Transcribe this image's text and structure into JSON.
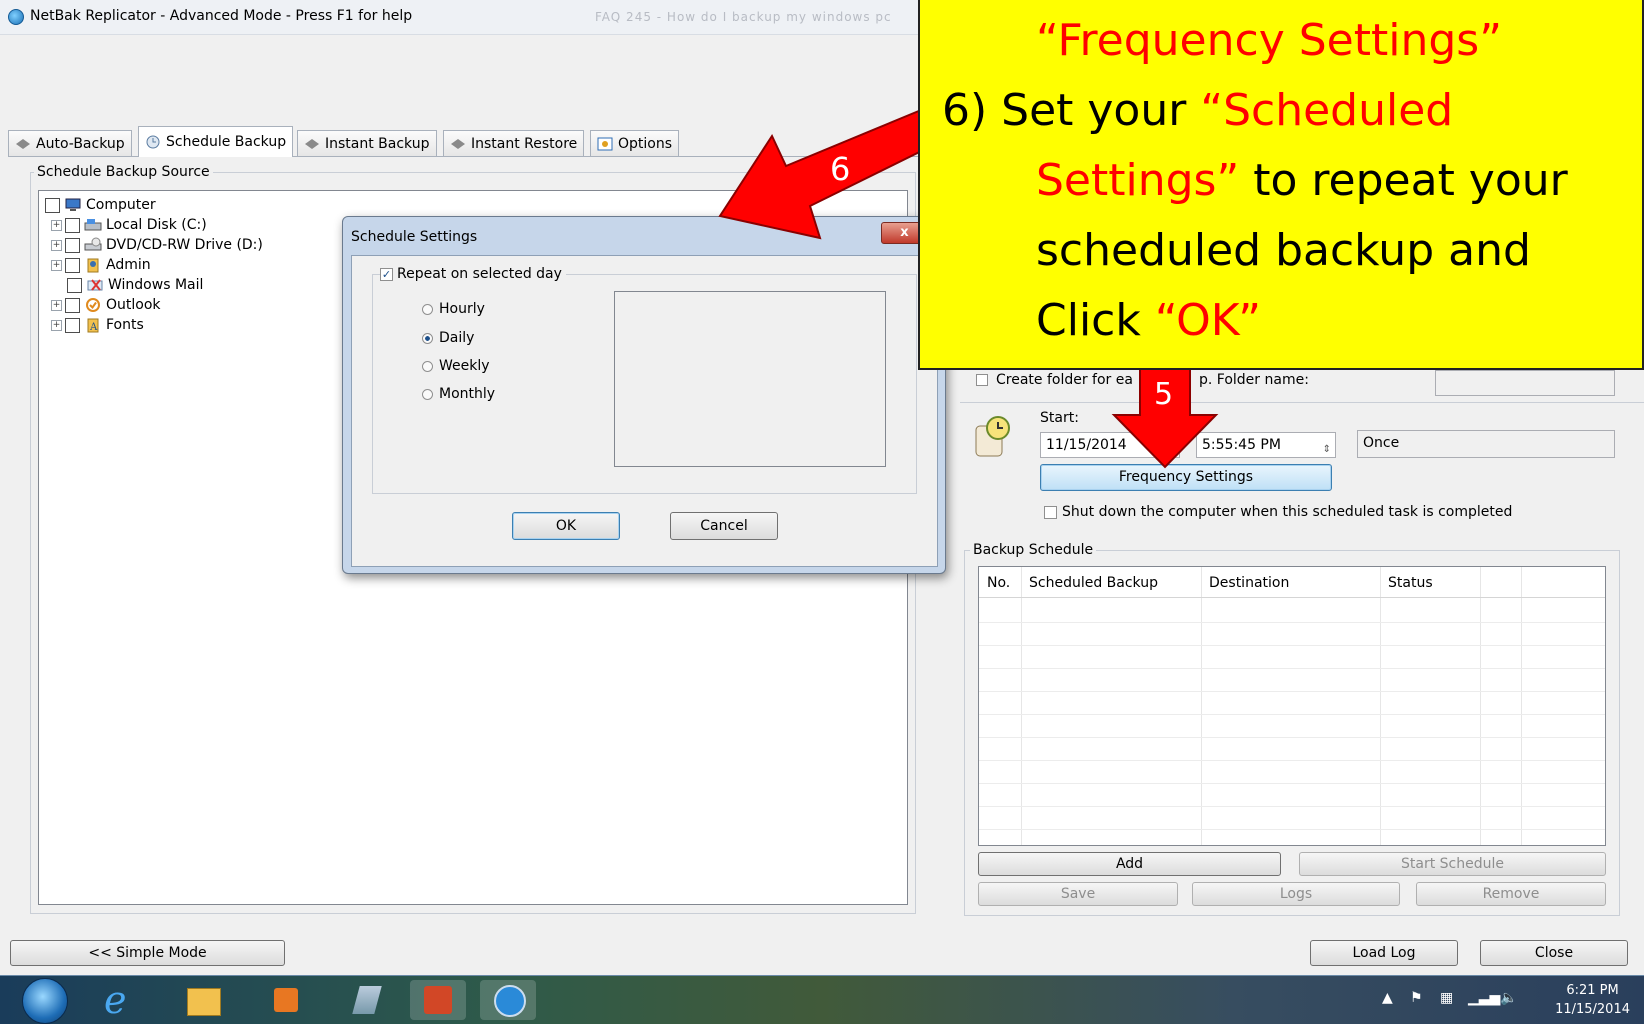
{
  "window": {
    "title": "NetBak Replicator - Advanced Mode - Press F1 for help",
    "background_tab_title": "FAQ 245 - How do I backup my windows pc"
  },
  "tabs": [
    {
      "label": "Auto-Backup",
      "icon": "auto-backup-icon"
    },
    {
      "label": "Schedule Backup",
      "icon": "schedule-icon",
      "active": true
    },
    {
      "label": "Instant Backup",
      "icon": "instant-backup-icon"
    },
    {
      "label": "Instant Restore",
      "icon": "restore-icon"
    },
    {
      "label": "Options",
      "icon": "options-icon"
    }
  ],
  "source": {
    "group_label": "Schedule Backup Source",
    "tree": [
      {
        "label": "Computer",
        "icon": "computer-icon"
      },
      {
        "label": "Local Disk (C:)",
        "icon": "drive-icon"
      },
      {
        "label": "DVD/CD-RW Drive (D:)",
        "icon": "dvd-icon"
      },
      {
        "label": "Admin",
        "icon": "user-folder-icon"
      },
      {
        "label": "Windows Mail",
        "icon": "mail-icon"
      },
      {
        "label": "Outlook",
        "icon": "outlook-icon"
      },
      {
        "label": "Fonts",
        "icon": "fonts-icon"
      }
    ]
  },
  "dialog": {
    "title": "Schedule Settings",
    "close_label": "x",
    "repeat_label": "Repeat on selected day",
    "repeat_checked": true,
    "options": [
      "Hourly",
      "Daily",
      "Weekly",
      "Monthly"
    ],
    "selected_option": "Daily",
    "ok_label": "OK",
    "cancel_label": "Cancel"
  },
  "schedule": {
    "create_folder_label_a": "Create folder for ea",
    "create_folder_label_b": "p. Folder name:",
    "start_label": "Start:",
    "start_date": "11/15/2014",
    "start_time": "5:55:45 PM",
    "frequency_value": "Once",
    "frequency_button": "Frequency Settings",
    "shutdown_label": "Shut down the computer when this scheduled task is completed"
  },
  "backup_schedule": {
    "group_label": "Backup Schedule",
    "columns": [
      "No.",
      "Scheduled Backup",
      "Destination",
      "Status"
    ],
    "add_label": "Add",
    "start_schedule_label": "Start Schedule",
    "save_label": "Save",
    "logs_label": "Logs",
    "remove_label": "Remove"
  },
  "footer": {
    "simple_mode_label": "<< Simple Mode",
    "load_log_label": "Load Log",
    "close_label": "Close"
  },
  "annotations": {
    "arrow_6_label": "6",
    "arrow_5_label": "5",
    "callout_lines": [
      {
        "parts": [
          {
            "text": "“Frequency Settings”",
            "red": true
          }
        ]
      },
      {
        "parts": [
          {
            "text": "6)  Set your ",
            "red": false
          },
          {
            "text": "“Scheduled",
            "red": true
          }
        ]
      },
      {
        "parts": [
          {
            "text": "Settings”",
            "red": true
          },
          {
            "text": " to repeat your",
            "red": false
          }
        ]
      },
      {
        "parts": [
          {
            "text": "scheduled backup and",
            "red": false
          }
        ]
      },
      {
        "parts": [
          {
            "text": "Click ",
            "red": false
          },
          {
            "text": "“OK”",
            "red": true
          }
        ]
      }
    ]
  },
  "taskbar": {
    "time": "6:21 PM",
    "date": "11/15/2014",
    "apps": [
      "start-orb",
      "internet-explorer-icon",
      "file-explorer-icon",
      "media-player-icon",
      "app-icon",
      "powerpoint-icon",
      "backup-clock-icon"
    ]
  }
}
